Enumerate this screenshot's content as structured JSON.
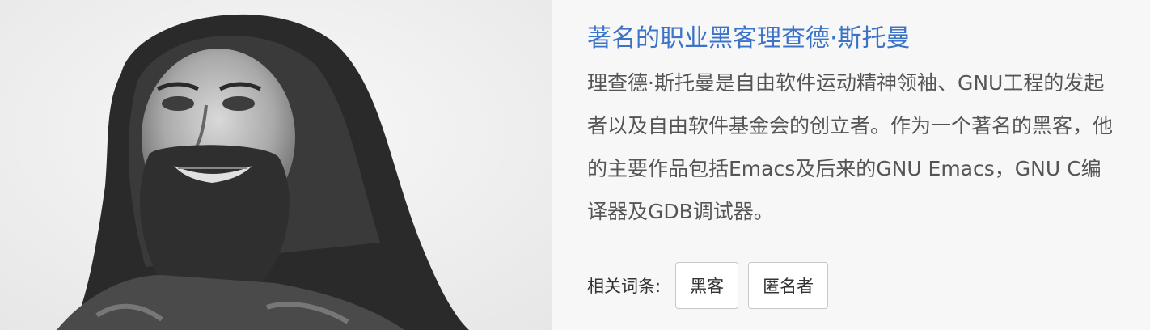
{
  "article": {
    "title": "著名的职业黑客理查德·斯托曼",
    "description": "理查德·斯托曼是自由软件运动精神领袖、GNU工程的发起者以及自由软件基金会的创立者。作为一个著名的黑客，他的主要作品包括Emacs及后来的GNU Emacs，GNU C编译器及GDB调试器。",
    "photo_subject": "portrait-photo",
    "colors": {
      "title": "#3b73c8",
      "text": "#555555",
      "panel_bg": "#f7f7f7"
    }
  },
  "related": {
    "label": "相关词条:",
    "tags": [
      "黑客",
      "匿名者"
    ]
  }
}
